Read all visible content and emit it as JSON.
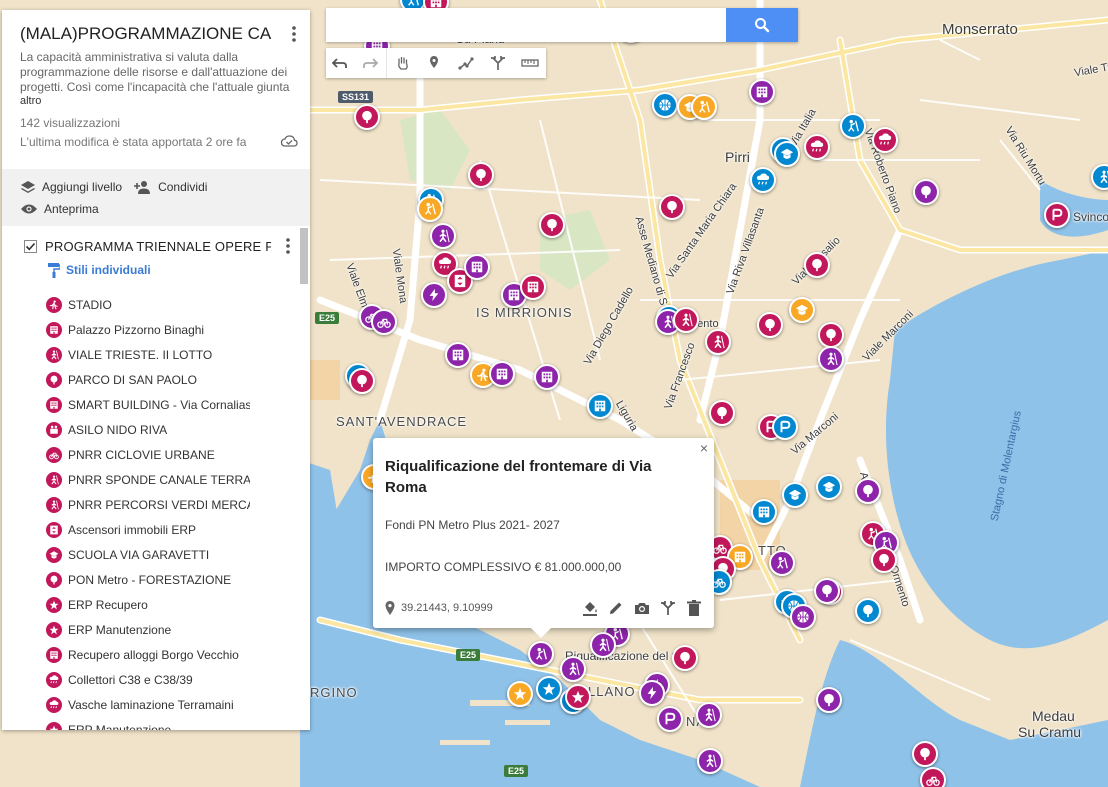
{
  "search": {
    "placeholder": ""
  },
  "panel": {
    "title": "(MALA)PROGRAMMAZIONE CAGLIARI",
    "description": "La capacità amministrativa si valuta dalla programmazione delle risorse e dall'attuazione dei progetti. Così come l'incapacità che l'attuale giunta",
    "more": "altro",
    "views": "142 visualizzazioni",
    "last_edit": "L'ultima modifica è stata apportata 2 ore fa",
    "actions": {
      "add_layer": "Aggiungi livello",
      "share": "Condividi",
      "preview": "Anteprima"
    },
    "layer": {
      "title": "PROGRAMMA TRIENNALE OPERE PUBBLICHE",
      "styles": "Stili individuali",
      "items": [
        {
          "label": "STADIO",
          "color": "#c2185b",
          "icon": "runner"
        },
        {
          "label": "Palazzo Pizzorno Binaghi",
          "color": "#c2185b",
          "icon": "building"
        },
        {
          "label": "VIALE TRIESTE. II LOTTO",
          "color": "#c2185b",
          "icon": "walker"
        },
        {
          "label": "PARCO DI SAN PAOLO",
          "color": "#c2185b",
          "icon": "tree"
        },
        {
          "label": "SMART BUILDING - Via Cornalias",
          "color": "#c2185b",
          "icon": "building"
        },
        {
          "label": "ASILO NIDO RIVA",
          "color": "#c2185b",
          "icon": "family"
        },
        {
          "label": "PNRR CICLOVIE URBANE",
          "color": "#c2185b",
          "icon": "bike"
        },
        {
          "label": "PNRR SPONDE CANALE TERRAMAINI",
          "color": "#c2185b",
          "icon": "walker"
        },
        {
          "label": "PNRR PERCORSI VERDI MERCATI",
          "color": "#c2185b",
          "icon": "walker"
        },
        {
          "label": "Ascensori immobili ERP",
          "color": "#c2185b",
          "icon": "elevator"
        },
        {
          "label": "SCUOLA VIA GARAVETTI",
          "color": "#c2185b",
          "icon": "school"
        },
        {
          "label": "PON Metro - FORESTAZIONE",
          "color": "#c2185b",
          "icon": "tree"
        },
        {
          "label": "ERP Recupero",
          "color": "#c2185b",
          "icon": "star"
        },
        {
          "label": "ERP Manutenzione",
          "color": "#c2185b",
          "icon": "star"
        },
        {
          "label": "Recupero alloggi Borgo Vecchio",
          "color": "#c2185b",
          "icon": "building"
        },
        {
          "label": "Collettori C38 e C38/39",
          "color": "#c2185b",
          "icon": "rain"
        },
        {
          "label": "Vasche laminazione Terramaini",
          "color": "#c2185b",
          "icon": "rain"
        },
        {
          "label": "ERP Manutenzione",
          "color": "#c2185b",
          "icon": "star"
        }
      ]
    }
  },
  "map": {
    "labels": {
      "monserrato": "Monserrato",
      "pirri": "Pirri",
      "is_mirrionis": "IS MIRRIONIS",
      "sant_avendrace": "SANT'AVENDRACE",
      "medau": "Medau",
      "su_cramu": "Su Cramu",
      "stagno": "Stagno di Molentargius",
      "svincolo": "Svinco",
      "viale_elmas": "Viale Elmas",
      "viale_monastir": "Viale Mona",
      "asse_mediano": "Asse Mediano di S",
      "via_diego_cadello": "Via Diego Cadello",
      "via_santa_maria_chiara": "Via Santa Maria Chiara",
      "via_riva_villasanta": "Via Riva Villasanta",
      "viale_vesalio": "Viale Vesalio",
      "viale_marconi": "Viale Marconi",
      "via_marconi": "Via Marconi",
      "via_italia": "Via Italia",
      "via_roberto_piano": "Via Roberto Piano",
      "via_riu_mortu": "Via Riu Mortu",
      "viale_trieste_label": "Viale Tries",
      "via_francesco": "Via Francesco",
      "liguria": "Liguria",
      "su_planu": "Su Planu",
      "ormento": "Ormento",
      "gigno": "RGINO",
      "ellanova": "LLANO",
      "poetto": "TTO",
      "nia": "NA",
      "mento": "mento",
      "riq_label": "Riqualificazione del f…",
      "a_label": "A"
    },
    "roads": {
      "ss131": "SS131",
      "e25a": "E25",
      "e25b": "E25",
      "e25c": "E25"
    },
    "colors": {
      "magenta": "#c2185b",
      "purple": "#8e24aa",
      "blue": "#0288d1",
      "yellow": "#f9a825"
    }
  },
  "popup": {
    "title": "Riqualificazione del frontemare di Via Roma",
    "funding": "Fondi PN Metro Plus 2021- 2027",
    "amount": "IMPORTO COMPLESSIVO € 81.000.000,00",
    "coords": "39.21443, 9.10999",
    "close": "×"
  }
}
